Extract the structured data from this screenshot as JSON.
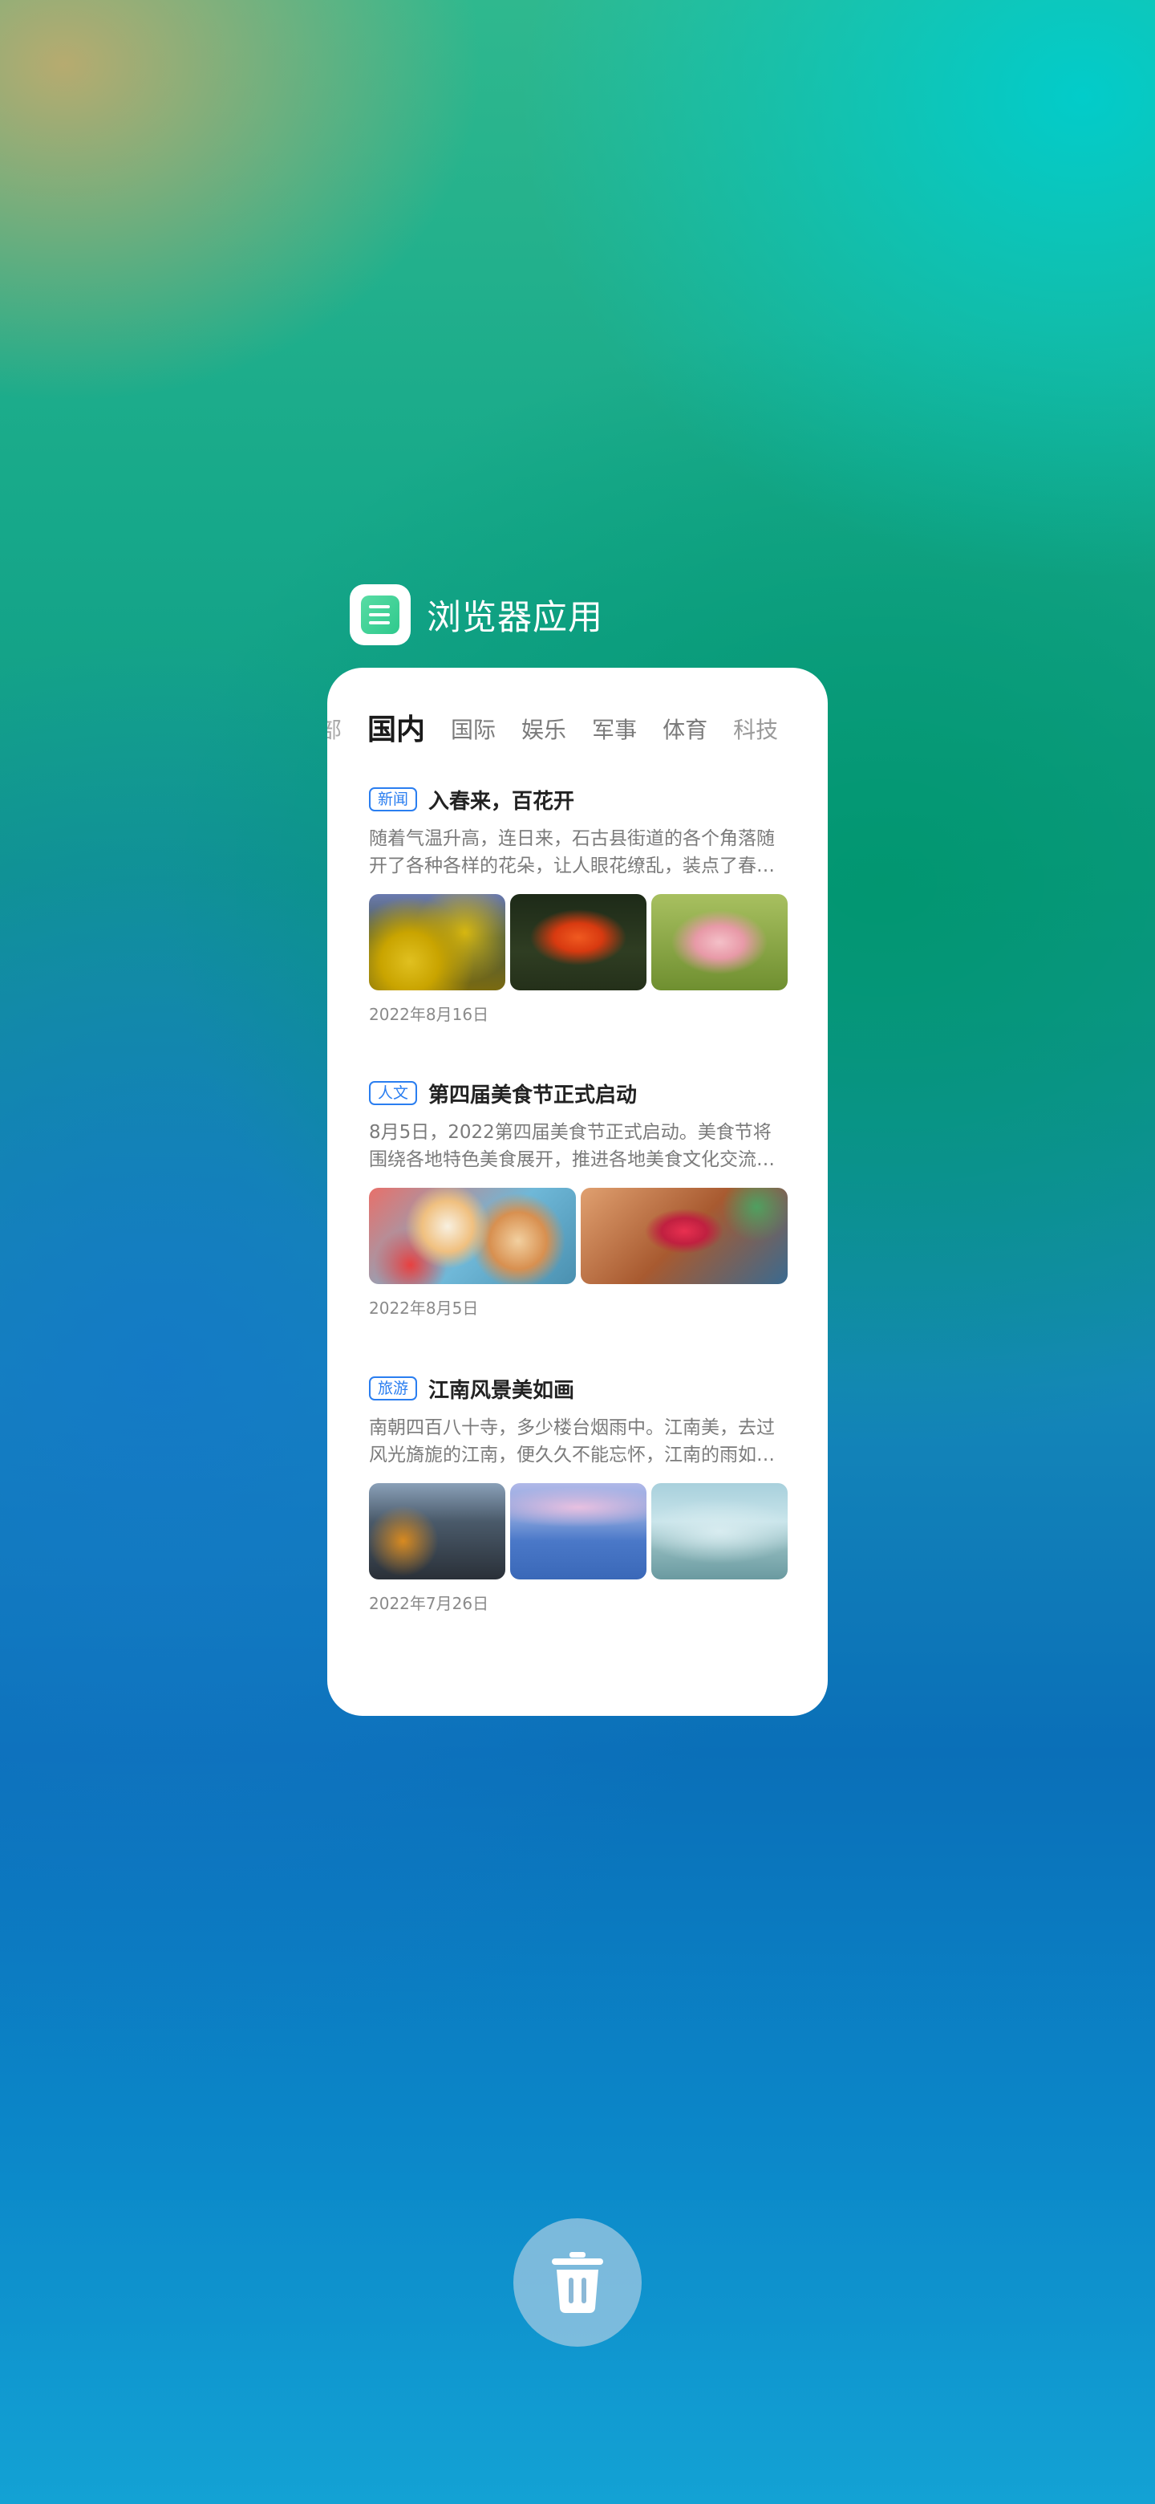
{
  "app": {
    "name": "浏览器应用"
  },
  "tabs": {
    "items": [
      {
        "label": "部",
        "partial": "left"
      },
      {
        "label": "国内",
        "active": true
      },
      {
        "label": "国际"
      },
      {
        "label": "娱乐"
      },
      {
        "label": "军事"
      },
      {
        "label": "体育"
      },
      {
        "label": "科技",
        "partial": "right"
      }
    ]
  },
  "articles": [
    {
      "tag": "新闻",
      "title": "入春来，百花开",
      "summary": "随着气温升高，连日来，石古县街道的各个角落随开了各种各样的花朵，让人眼花缭乱，装点了春…",
      "date": "2022年8月16日",
      "images": [
        "yellow-flowers-photo",
        "red-flower-photo",
        "pink-flower-photo"
      ]
    },
    {
      "tag": "人文",
      "title": "第四届美食节正式启动",
      "summary": "8月5日，2022第四届美食节正式启动。美食节将围绕各地特色美食展开，推进各地美食文化交流…",
      "date": "2022年8月5日",
      "images": [
        "donuts-photo",
        "berry-tart-photo"
      ]
    },
    {
      "tag": "旅游",
      "title": "江南风景美如画",
      "summary": "南朝四百八十寺，多少楼台烟雨中。江南美，去过风光旖旎的江南，便久久不能忘怀，江南的雨如…",
      "date": "2022年7月26日",
      "images": [
        "autumn-lake-photo",
        "misty-lake-photo",
        "mountain-mist-photo"
      ]
    }
  ],
  "colors": {
    "tag_blue": "#2a7ef0",
    "card_bg": "#ffffff"
  },
  "icons": {
    "app": "browser-app-icon",
    "delete": "trash-icon"
  }
}
